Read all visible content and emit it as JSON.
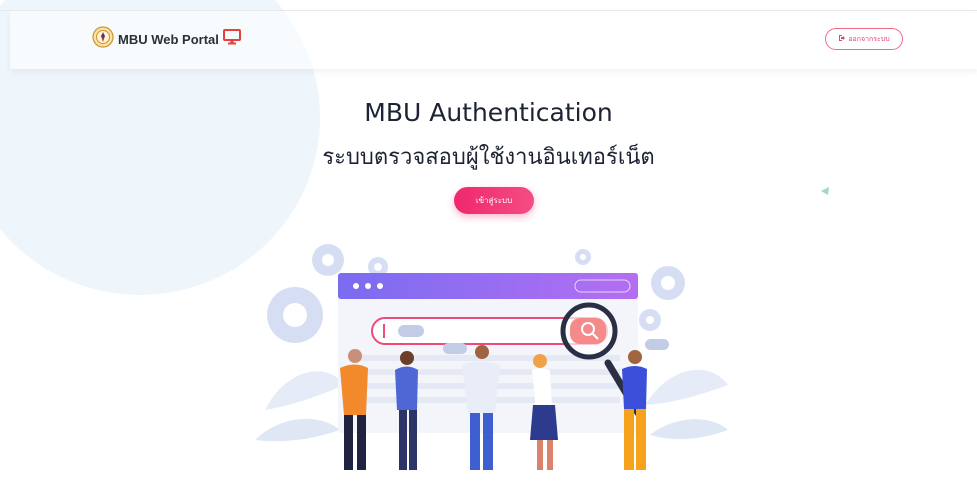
{
  "header": {
    "brand_name": "MBU Web Portal",
    "logo_icon": "university-seal-logo",
    "monitor_icon": "monitor-icon",
    "logout_label": "ออกจากระบบ",
    "logout_icon": "logout-icon"
  },
  "hero": {
    "title": "MBU Authentication",
    "subtitle": "ระบบตรวจสอบผู้ใช้งานอินเทอร์เน็ต",
    "login_label": "เข้าสู่ระบบ"
  },
  "colors": {
    "accent_pink": "#f0276e",
    "monitor_red": "#e8403a",
    "browser_purple": "#8a5cf6",
    "heading": "#1d2333"
  }
}
